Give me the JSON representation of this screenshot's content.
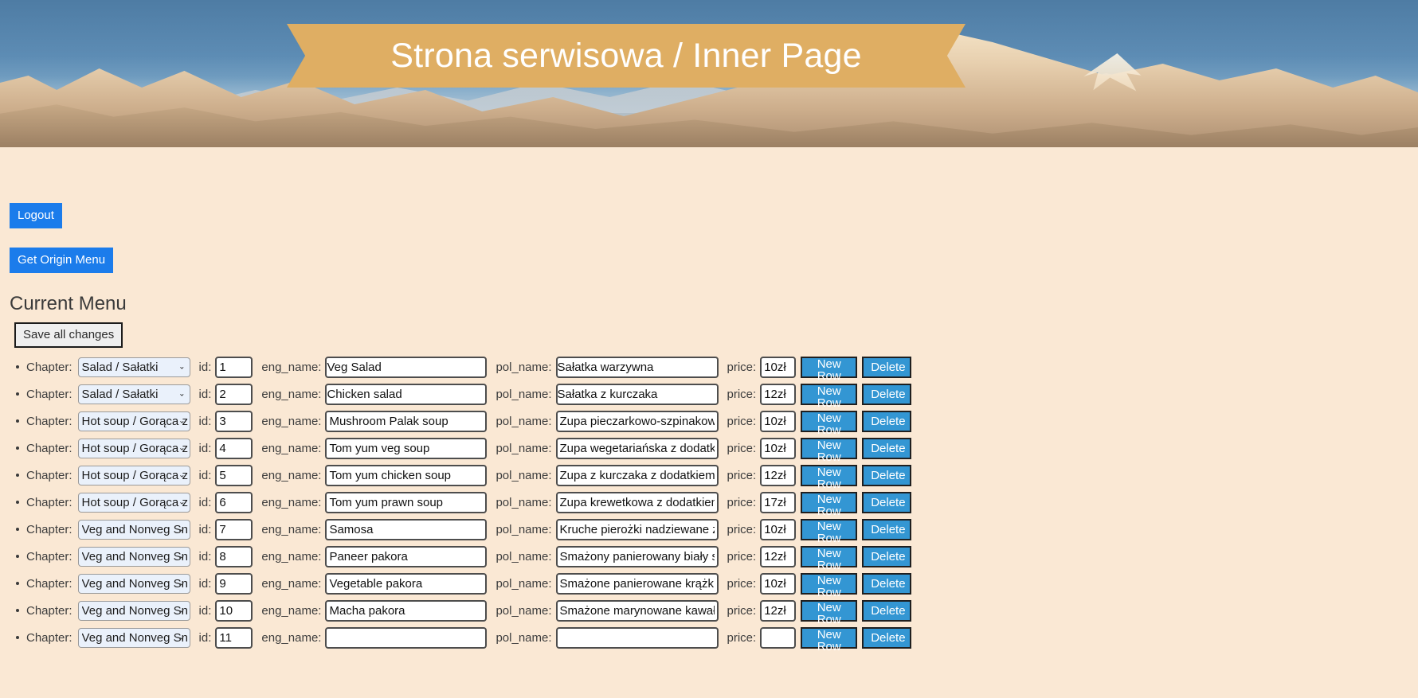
{
  "hero": {
    "ribbon_title": "Strona serwisowa / Inner Page",
    "ribbon_color": "#dfae63"
  },
  "page": {
    "background_color": "#fae8d4",
    "logout_label": "Logout",
    "get_origin_menu_label": "Get Origin Menu",
    "subtitle": "Current Menu",
    "save_all_label": "Save all changes",
    "accent_color": "#1b7ceb",
    "row_button_color": "#3396d3"
  },
  "labels": {
    "chapter": "Chapter:",
    "id": "id:",
    "eng_name": "eng_name:",
    "pol_name": "pol_name:",
    "price": "price:",
    "new_row": "New Row",
    "delete": "Delete"
  },
  "chapter_options": [
    "Salad / Sałatki",
    "Hot soup / Gorąca zupa",
    "Veg and Nonveg Snacks"
  ],
  "rows": [
    {
      "chapter": "Salad / Sałatki",
      "id": "1",
      "eng_name": "Veg Salad",
      "pol_name": "Sałatka warzywna",
      "price": "10zł",
      "flush": true
    },
    {
      "chapter": "Salad / Sałatki",
      "id": "2",
      "eng_name": "Chicken salad",
      "pol_name": "Sałatka z kurczaka",
      "price": "12zł",
      "flush": true
    },
    {
      "chapter": "Hot soup / Gorąca zupa",
      "id": "3",
      "eng_name": "Mushroom Palak soup",
      "pol_name": "Zupa pieczarkowo-szpinakowa",
      "price": "10zł",
      "flush": false
    },
    {
      "chapter": "Hot soup / Gorąca zupa",
      "id": "4",
      "eng_name": "Tom yum veg soup",
      "pol_name": "Zupa wegetariańska z dodatkami",
      "price": "10zł",
      "flush": false
    },
    {
      "chapter": "Hot soup / Gorąca zupa",
      "id": "5",
      "eng_name": "Tom yum chicken soup",
      "pol_name": "Zupa z kurczaka z dodatkiem",
      "price": "12zł",
      "flush": false
    },
    {
      "chapter": "Hot soup / Gorąca zupa",
      "id": "6",
      "eng_name": "Tom yum prawn soup",
      "pol_name": "Zupa krewetkowa z dodatkiem",
      "price": "17zł",
      "flush": false
    },
    {
      "chapter": "Veg and Nonveg Snacks",
      "id": "7",
      "eng_name": "Samosa",
      "pol_name": "Kruche pierożki nadziewane z",
      "price": "10zł",
      "flush": false
    },
    {
      "chapter": "Veg and Nonveg Snacks",
      "id": "8",
      "eng_name": "Paneer pakora",
      "pol_name": "Smażony panierowany biały ser",
      "price": "12zł",
      "flush": false
    },
    {
      "chapter": "Veg and Nonveg Snacks",
      "id": "9",
      "eng_name": "Vegetable pakora",
      "pol_name": "Smażone panierowane krążki",
      "price": "10zł",
      "flush": false
    },
    {
      "chapter": "Veg and Nonveg Snacks",
      "id": "10",
      "eng_name": "Macha pakora",
      "pol_name": "Smażone marynowane kawałki",
      "price": "12zł",
      "flush": false
    },
    {
      "chapter": "Veg and Nonveg Snacks",
      "id": "11",
      "eng_name": "",
      "pol_name": "",
      "price": "",
      "flush": false
    }
  ]
}
